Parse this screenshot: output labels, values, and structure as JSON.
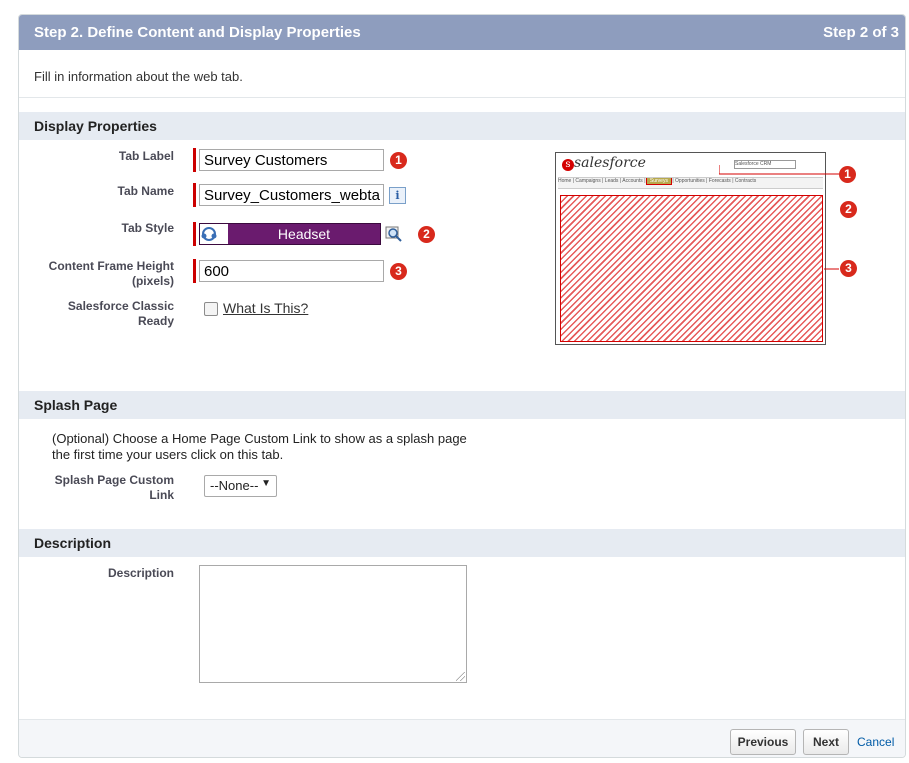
{
  "header": {
    "title": "Step 2. Define Content and Display Properties",
    "step_indicator": "Step 2 of 3"
  },
  "intro_text": "Fill in information about the web tab.",
  "display_properties": {
    "section_title": "Display Properties",
    "tab_label": {
      "label": "Tab Label",
      "value": "Survey Customers"
    },
    "tab_name": {
      "label": "Tab Name",
      "value": "Survey_Customers_webta",
      "info_icon": "i"
    },
    "tab_style": {
      "label": "Tab Style",
      "value": "Headset"
    },
    "content_frame_height": {
      "label": "Content Frame Height (pixels)",
      "value": "600"
    },
    "classic_ready": {
      "label": "Salesforce Classic Ready",
      "checked": false,
      "link": "What Is This?"
    },
    "callouts": [
      "1",
      "2",
      "3"
    ]
  },
  "preview": {
    "brand": "salesforce",
    "tabs": [
      "Home",
      "Campaigns",
      "Leads",
      "Accounts",
      "Surveys",
      "Opportunities",
      "Forecasts",
      "Contracts"
    ],
    "app_menu": "Salesforce CRM",
    "callouts": [
      "1",
      "2",
      "3"
    ],
    "hatch_color": "#e65a5a"
  },
  "splash_page": {
    "section_title": "Splash Page",
    "help_text": "(Optional) Choose a Home Page Custom Link to show as a splash page the first time your users click on this tab.",
    "custom_link": {
      "label": "Splash Page Custom Link",
      "value": "--None--"
    }
  },
  "description": {
    "section_title": "Description",
    "label": "Description",
    "value": ""
  },
  "footer": {
    "previous": "Previous",
    "next": "Next",
    "cancel": "Cancel"
  },
  "colors": {
    "header_bg": "#8e9dbe",
    "section_bg": "#e6ebf2",
    "required_bar": "#cc0000",
    "tab_style_bg": "#6a1b6e",
    "callout": "#d8291c"
  }
}
